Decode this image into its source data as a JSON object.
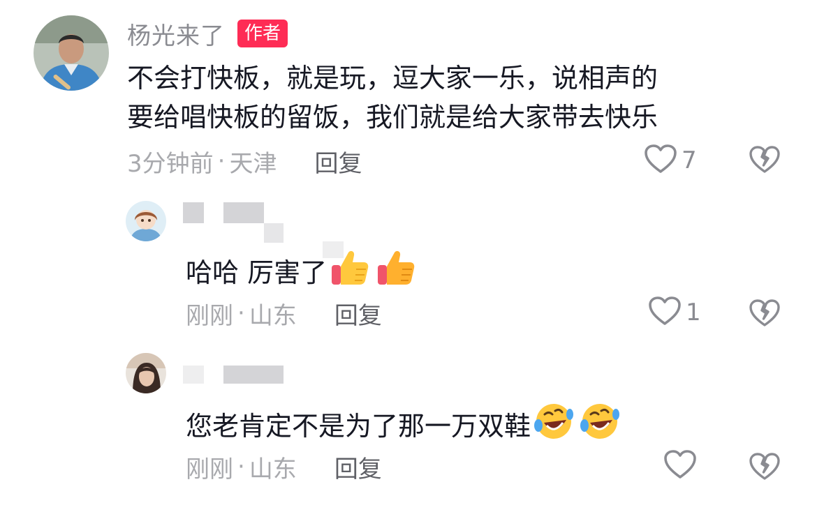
{
  "comments": [
    {
      "author": "杨光来了",
      "author_badge": "作者",
      "text_line1": "不会打快板，就是玩，逗大家一乐，说相声的",
      "text_line2": "要给唱快板的留饭，我们就是给大家带去快乐",
      "time": "3分钟前",
      "location": "天津",
      "reply_label": "回复",
      "likes": "7"
    }
  ],
  "replies": [
    {
      "text": "哈哈 厉害了",
      "emojis": [
        "thumbs-up-emoji",
        "thumbs-up-emoji"
      ],
      "time": "刚刚",
      "location": "山东",
      "reply_label": "回复",
      "likes": "1"
    },
    {
      "text": "您老肯定不是为了那一万双鞋",
      "emojis": [
        "rolling-on-floor-laughing-emoji",
        "rolling-on-floor-laughing-emoji"
      ],
      "time": "刚刚",
      "location": "山东",
      "reply_label": "回复",
      "likes": ""
    }
  ],
  "separator": "·",
  "colors": {
    "badge": "#fe2c55",
    "name": "#8a8b91",
    "meta": "#a8a9ad",
    "text": "#161823"
  }
}
